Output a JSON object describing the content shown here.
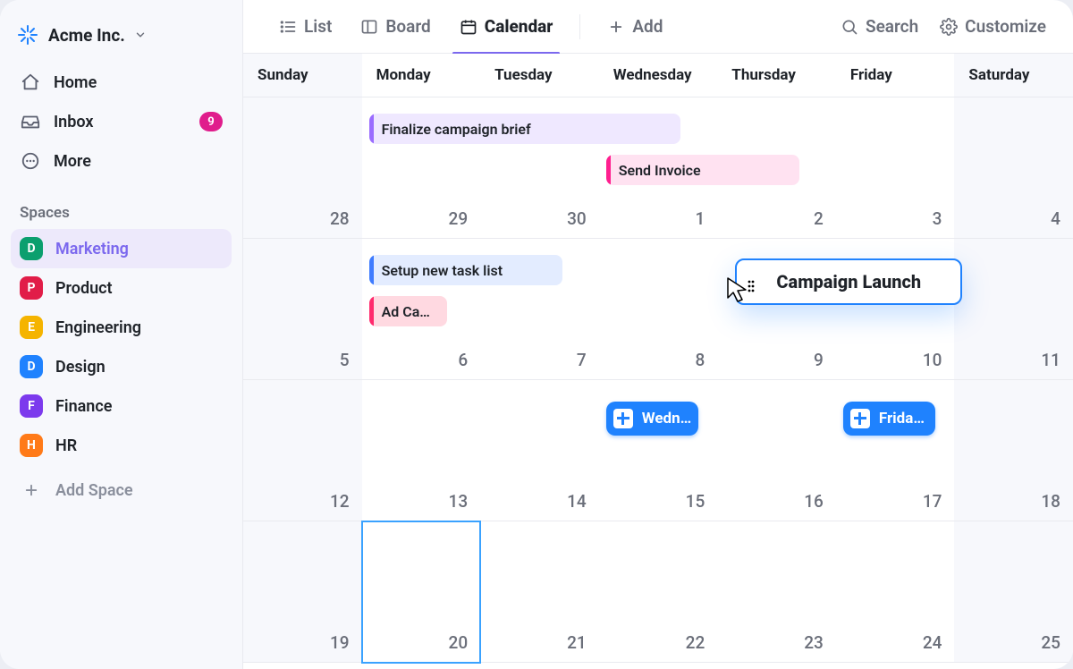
{
  "workspace": {
    "name": "Acme Inc."
  },
  "nav": {
    "home": "Home",
    "inbox": "Inbox",
    "inbox_badge": "9",
    "more": "More"
  },
  "spaces": {
    "title": "Spaces",
    "items": [
      {
        "letter": "D",
        "label": "Marketing",
        "color": "#0b9f6e",
        "active": true
      },
      {
        "letter": "P",
        "label": "Product",
        "color": "#e11d48"
      },
      {
        "letter": "E",
        "label": "Engineering",
        "color": "#f5b400"
      },
      {
        "letter": "D",
        "label": "Design",
        "color": "#1f82fe"
      },
      {
        "letter": "F",
        "label": "Finance",
        "color": "#7c3aed"
      },
      {
        "letter": "H",
        "label": "HR",
        "color": "#ff7a18"
      }
    ],
    "add": "Add Space"
  },
  "views": {
    "list": "List",
    "board": "Board",
    "calendar": "Calendar",
    "add": "Add"
  },
  "tools": {
    "search": "Search",
    "customize": "Customize"
  },
  "calendar": {
    "days": [
      "Sunday",
      "Monday",
      "Tuesday",
      "Wednesday",
      "Thursday",
      "Friday",
      "Saturday"
    ],
    "weeks": [
      [
        "28",
        "29",
        "30",
        "1",
        "2",
        "3",
        "4"
      ],
      [
        "5",
        "6",
        "7",
        "8",
        "9",
        "10",
        "11"
      ],
      [
        "12",
        "13",
        "14",
        "15",
        "16",
        "17",
        "18"
      ],
      [
        "19",
        "20",
        "21",
        "22",
        "23",
        "24",
        "25"
      ]
    ],
    "today": {
      "week": 3,
      "day": 1
    }
  },
  "events": {
    "finalize_brief": "Finalize campaign brief",
    "send_invoice": "Send Invoice",
    "setup_tasklist": "Setup new task list",
    "ad_campaign": "Ad Ca…",
    "wed_sync": "Wedn…",
    "fri_sync": "Frida…",
    "drag_card": "Campaign Launch"
  }
}
